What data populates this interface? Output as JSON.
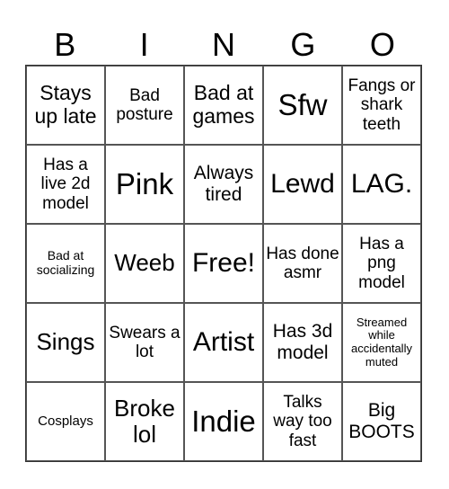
{
  "header": [
    "B",
    "I",
    "N",
    "G",
    "O"
  ],
  "cells": [
    {
      "text": "Stays up late",
      "size": "s23"
    },
    {
      "text": "Bad posture",
      "size": "s19"
    },
    {
      "text": "Bad at games",
      "size": "s23"
    },
    {
      "text": "Sfw",
      "size": "s32"
    },
    {
      "text": "Fangs or shark teeth",
      "size": "s19"
    },
    {
      "text": "Has a live 2d model",
      "size": "s19"
    },
    {
      "text": "Pink",
      "size": "s32"
    },
    {
      "text": "Always tired",
      "size": "s21"
    },
    {
      "text": "Lewd",
      "size": "s30"
    },
    {
      "text": "LAG.",
      "size": "s30"
    },
    {
      "text": "Bad at socializing",
      "size": "s14"
    },
    {
      "text": "Weeb",
      "size": "s26"
    },
    {
      "text": "Free!",
      "size": "s30"
    },
    {
      "text": "Has done asmr",
      "size": "s19"
    },
    {
      "text": "Has a png model",
      "size": "s19"
    },
    {
      "text": "Sings",
      "size": "s26"
    },
    {
      "text": "Swears a lot",
      "size": "s19"
    },
    {
      "text": "Artist",
      "size": "s30"
    },
    {
      "text": "Has 3d model",
      "size": "s21"
    },
    {
      "text": "Streamed while accidentally muted",
      "size": "s13"
    },
    {
      "text": "Cosplays",
      "size": "s15"
    },
    {
      "text": "Broke lol",
      "size": "s26"
    },
    {
      "text": "Indie",
      "size": "s32"
    },
    {
      "text": "Talks way too fast",
      "size": "s19"
    },
    {
      "text": "Big BOOTS",
      "size": "s21"
    }
  ]
}
